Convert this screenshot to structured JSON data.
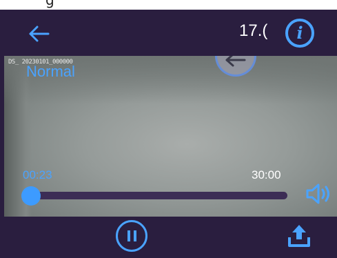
{
  "header": {
    "time_text": "17.(",
    "info_label": "i",
    "top_partial_text": "g"
  },
  "video": {
    "filename": "DS_  20230101_000000",
    "mode_label": "Normal"
  },
  "player": {
    "elapsed": "00:23",
    "duration": "30:00",
    "progress_fraction": 0.03
  },
  "icons": {
    "back": "arrow-left-icon",
    "info": "info-icon",
    "overlay_back": "arrow-left-icon",
    "volume": "speaker-icon",
    "pause": "pause-icon",
    "share": "upload-icon"
  },
  "colors": {
    "background": "#2a1e3f",
    "accent": "#4aa3ff",
    "track": "#3c2d55"
  }
}
